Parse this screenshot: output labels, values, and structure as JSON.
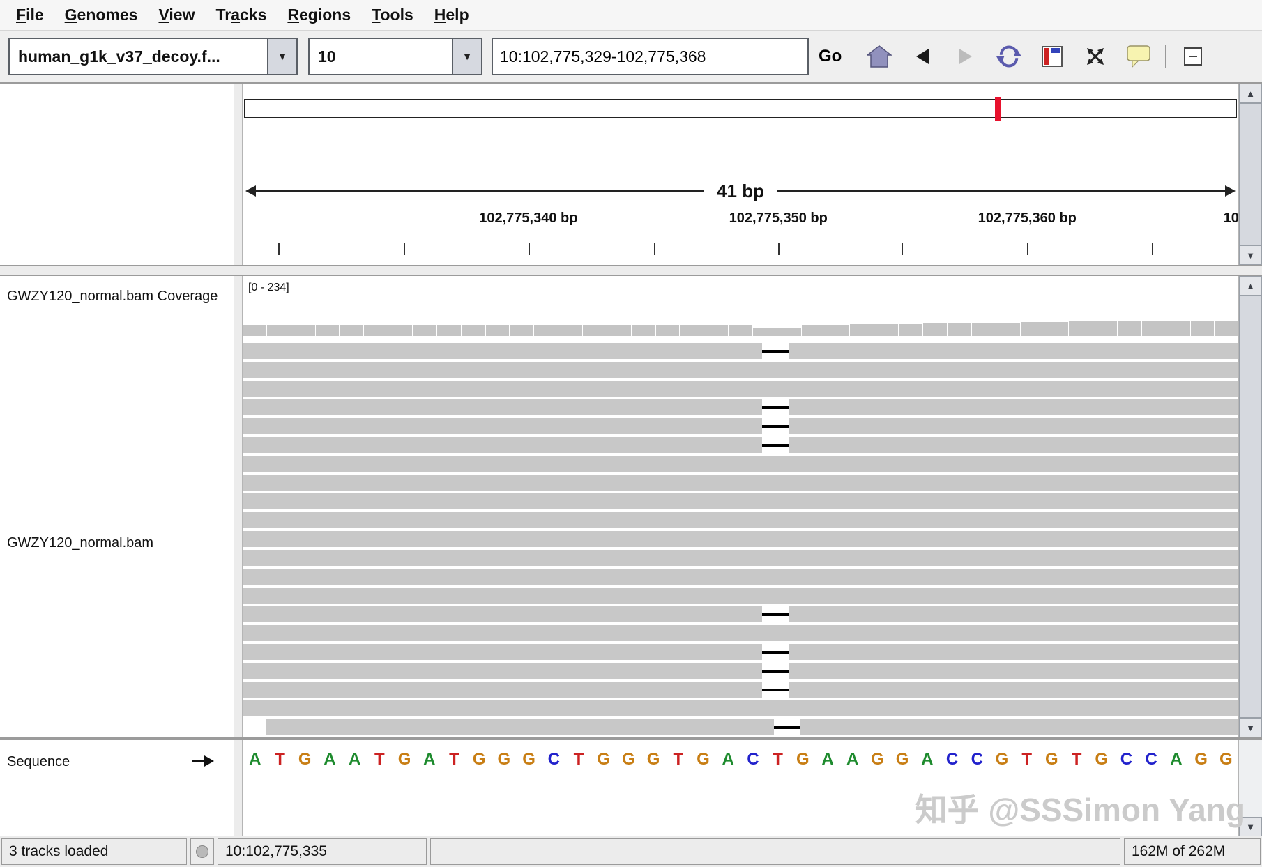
{
  "menu": {
    "items": [
      {
        "label": "File",
        "mnemonic_index": 0
      },
      {
        "label": "Genomes",
        "mnemonic_index": 0
      },
      {
        "label": "View",
        "mnemonic_index": 0
      },
      {
        "label": "Tracks",
        "mnemonic_index": 2
      },
      {
        "label": "Regions",
        "mnemonic_index": 0
      },
      {
        "label": "Tools",
        "mnemonic_index": 0
      },
      {
        "label": "Help",
        "mnemonic_index": 0
      }
    ]
  },
  "toolbar": {
    "genome_value": "human_g1k_v37_decoy.f...",
    "chromosome_value": "10",
    "locus_value": "10:102,775,329-102,775,368",
    "go_label": "Go",
    "icons": [
      "home-icon",
      "back-icon",
      "forward-icon",
      "refresh-icon",
      "region-navigator-icon",
      "fit-data-to-window-icon",
      "tooltip-toggle-icon",
      "collapse-icon"
    ]
  },
  "icons": {
    "chevron_down": "▼",
    "scroll_up": "▲",
    "scroll_down": "▼"
  },
  "ruler": {
    "span_label": "41 bp",
    "labels": [
      {
        "text": "102,775,340 bp",
        "x_pct": 28.7,
        "clip": false
      },
      {
        "text": "102,775,350 bp",
        "x_pct": 53.8,
        "clip": false
      },
      {
        "text": "102,775,360 bp",
        "x_pct": 78.8,
        "clip": false
      },
      {
        "text": "10",
        "x_pct": 98.5,
        "clip": true
      }
    ],
    "ticks_pct": [
      3.6,
      16.2,
      28.7,
      41.3,
      53.8,
      66.2,
      78.8,
      91.3
    ],
    "marker_pct": 75.7,
    "marker_color": "#e8112d"
  },
  "tracks": {
    "coverage_label": "GWZY120_normal.bam Coverage",
    "coverage_range": "[0 - 234]",
    "alignment_label": "GWZY120_normal.bam",
    "coverage_heights": [
      16,
      16,
      15,
      16,
      16,
      16,
      15,
      16,
      16,
      16,
      16,
      15,
      16,
      16,
      16,
      16,
      15,
      16,
      16,
      16,
      16,
      12,
      12,
      16,
      16,
      17,
      17,
      17,
      18,
      18,
      19,
      19,
      20,
      20,
      21,
      21,
      21,
      22,
      22,
      22,
      22
    ],
    "deletion": {
      "x_pct": 52.2,
      "width_pct": 2.7
    },
    "read_rows": [
      {
        "del": 1
      },
      {
        "del": 0
      },
      {
        "del": 0
      },
      {
        "del": 1
      },
      {
        "del": 1
      },
      {
        "del": 1
      },
      {
        "del": 0
      },
      {
        "del": 0
      },
      {
        "del": 0
      },
      {
        "del": 0
      },
      {
        "del": 0
      },
      {
        "del": 0
      },
      {
        "del": 0
      },
      {
        "del": 0
      },
      {
        "del": 1
      },
      {
        "del": 0
      },
      {
        "del": 1
      },
      {
        "del": 1
      },
      {
        "del": 1
      },
      {
        "del": 0
      },
      {
        "del": 1,
        "offset_pct": 2.4
      }
    ],
    "colors": {
      "read": "#c8c8c8",
      "coverage": "#c4c4c4",
      "deletion_line": "#000000"
    }
  },
  "sequence": {
    "label": "Sequence",
    "bases": "ATGAATGATGGGCTGGGTGACTGAAGGACCGTGTGCCAGG",
    "base_colors": {
      "A": "#1e8b2e",
      "C": "#2222cc",
      "G": "#c87e14",
      "T": "#cc2222"
    }
  },
  "status": {
    "tracks_loaded": "3 tracks loaded",
    "position": "10:102,775,335",
    "memory": "162M of 262M"
  },
  "watermark": "知乎 @SSSimon Yang"
}
